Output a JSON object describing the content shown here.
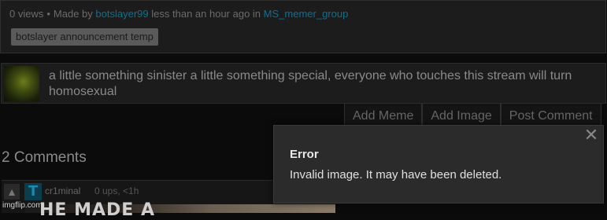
{
  "meta": {
    "views": "0 views",
    "made_by_prefix": "Made by",
    "author": "botslayer99",
    "time_prefix": "less than an hour ago in",
    "stream": "MS_memer_group",
    "tag": "botslayer announcement temp"
  },
  "caption": {
    "text": "a little something sinister a little something special, everyone who touches this stream will turn homosexual"
  },
  "tabs": [
    {
      "label": "Add Meme"
    },
    {
      "label": "Add Image"
    },
    {
      "label": "Post Comment"
    }
  ],
  "comments": {
    "title": "2 Comments",
    "first": {
      "avatar_letter": "T",
      "username": "cr1minal",
      "ups_time": "0 ups, <1h",
      "image_text": "HE MADE A"
    }
  },
  "watermark": "imgflip.com",
  "error_dialog": {
    "title": "Error",
    "message": "Invalid image. It may have been deleted.",
    "close_glyph": "✕"
  },
  "colors": {
    "link": "#0f6f8f",
    "background": "#0b0b0b",
    "dialog_bg": "#2b2b2b"
  }
}
